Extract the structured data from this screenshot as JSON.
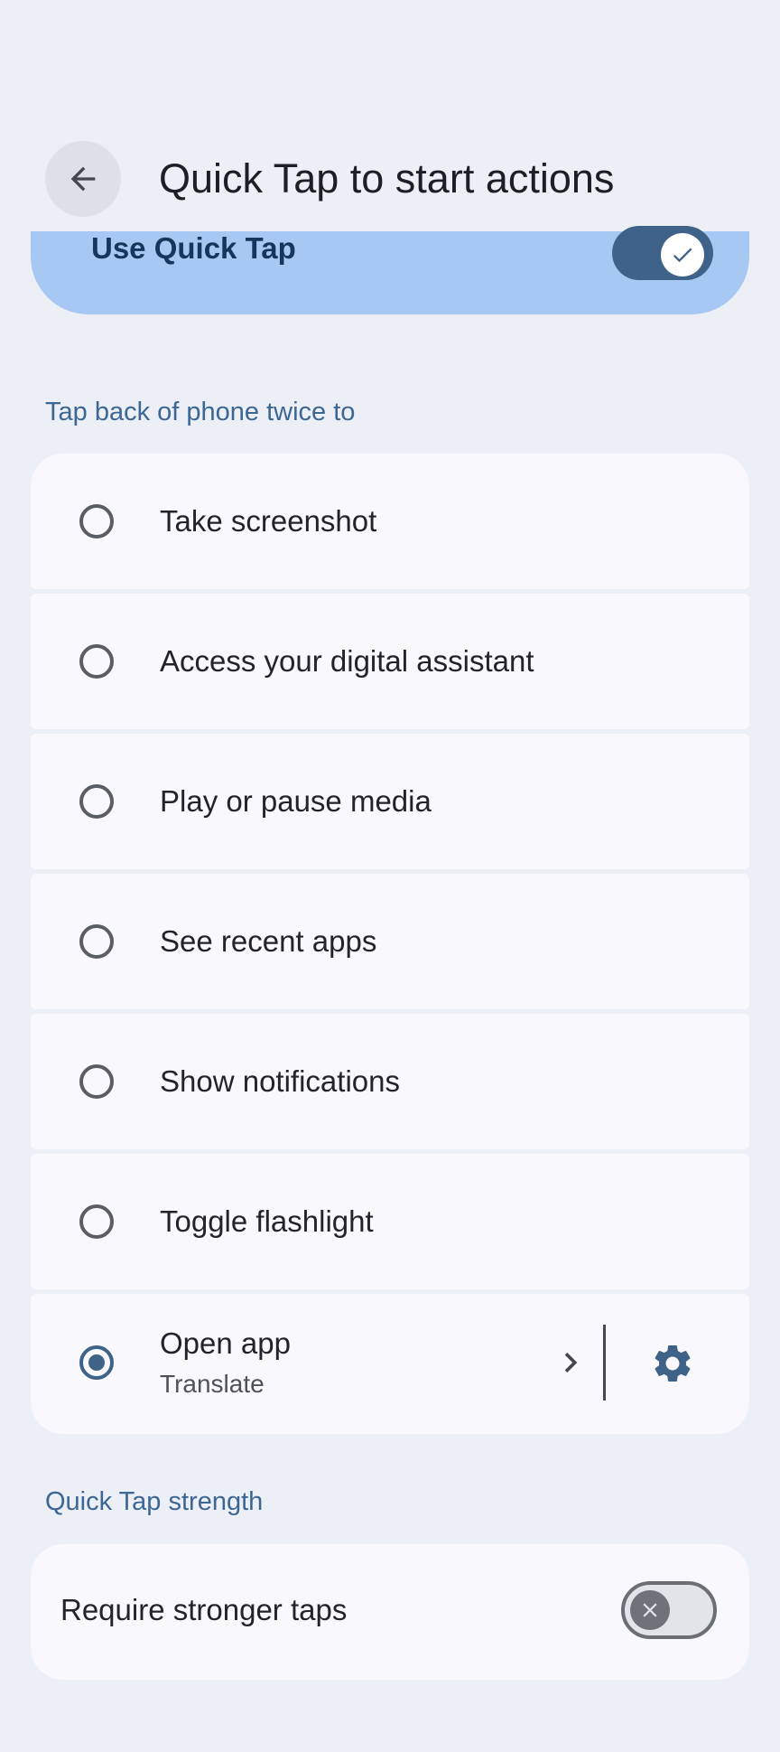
{
  "header": {
    "title": "Quick Tap to start actions",
    "back_icon": "arrow-back-icon"
  },
  "quick_tap": {
    "label": "Use Quick Tap",
    "enabled": true
  },
  "section_actions": {
    "title": "Tap back of phone twice to"
  },
  "options": [
    {
      "label": "Take screenshot",
      "selected": false
    },
    {
      "label": "Access your digital assistant",
      "selected": false
    },
    {
      "label": "Play or pause media",
      "selected": false
    },
    {
      "label": "See recent apps",
      "selected": false
    },
    {
      "label": "Show notifications",
      "selected": false
    },
    {
      "label": "Toggle flashlight",
      "selected": false
    },
    {
      "label": "Open app",
      "sublabel": "Translate",
      "selected": true
    }
  ],
  "section_strength": {
    "title": "Quick Tap strength"
  },
  "stronger_taps": {
    "label": "Require stronger taps",
    "enabled": false
  },
  "colors": {
    "background": "#eceff6",
    "accent": "#3f6289",
    "card": "#f9f9fd",
    "primary_container": "#a8c8f4"
  }
}
